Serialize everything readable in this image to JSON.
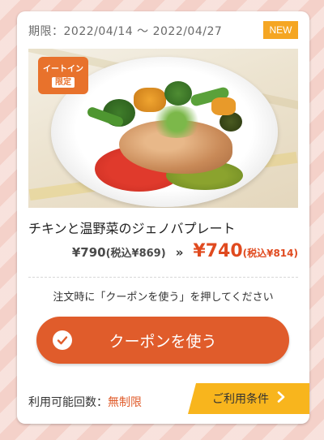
{
  "coupon": {
    "period_label": "期限：",
    "period": "2022/04/14 〜 2022/04/27",
    "badge": "NEW",
    "limited_tag_line1": "イートイン",
    "limited_tag_line2": "限定",
    "product_name": "チキンと温野菜のジェノバプレート",
    "old_price": "¥790",
    "old_price_tax": "(税込¥869)",
    "arrow": "»",
    "new_price": "¥740",
    "new_price_tax": "(税込¥814)",
    "instruction": "注文時に「クーポンを使う」を押してください",
    "use_button_label": "クーポンを使う",
    "usage_label": "利用可能回数：",
    "usage_value": "無制限",
    "conditions_label": "ご利用条件",
    "conditions_chevron": "›"
  },
  "colors": {
    "accent": "#e05c2b",
    "badge": "#f5a623",
    "conditions": "#f8b51d",
    "price": "#e04a1f"
  },
  "icons": [
    "check-icon",
    "chevron-right-icon"
  ]
}
